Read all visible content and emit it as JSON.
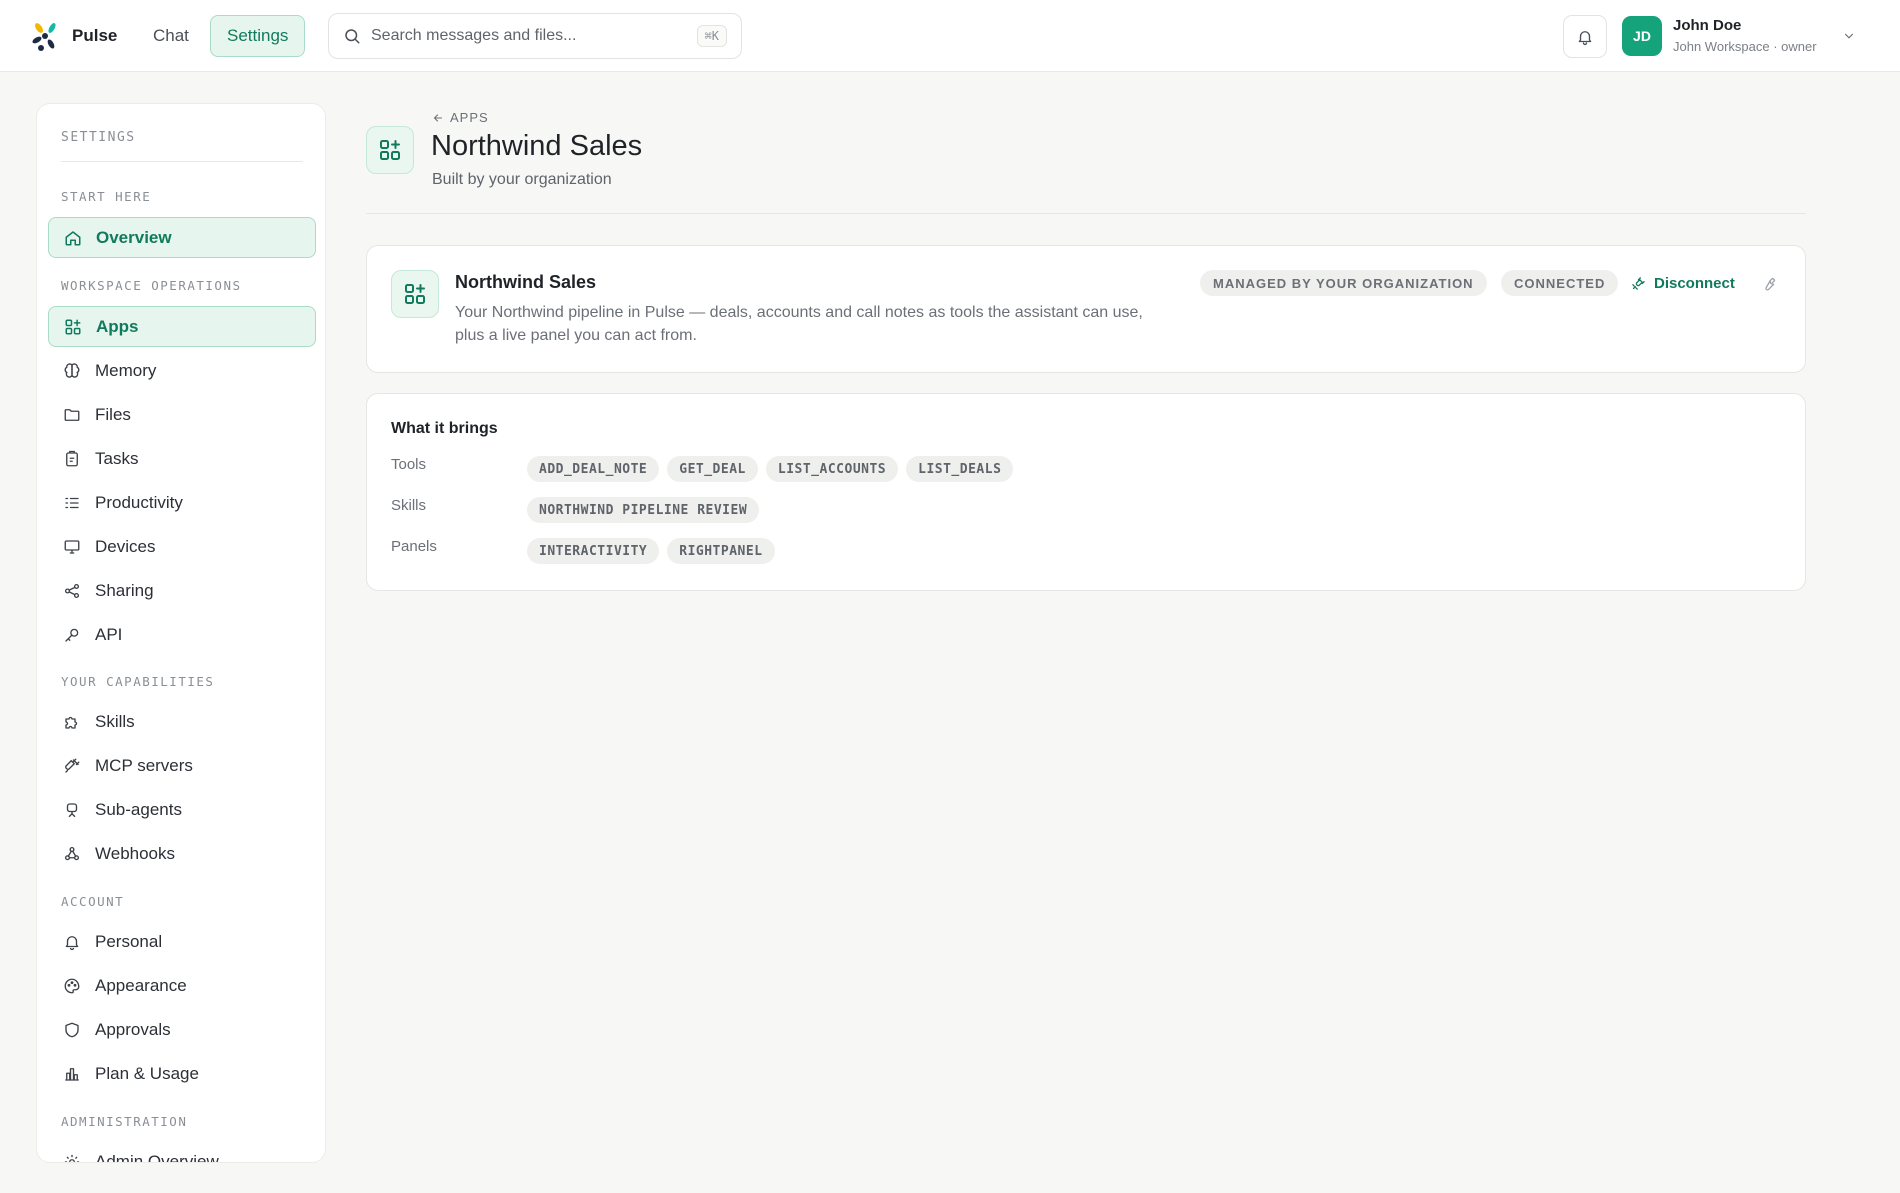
{
  "topbar": {
    "brand": "Pulse",
    "nav": {
      "chat": "Chat",
      "settings": "Settings"
    },
    "search": {
      "placeholder": "Search messages and files...",
      "shortcut": "⌘K"
    },
    "user": {
      "initials": "JD",
      "name": "John Doe",
      "subtitle": "John Workspace · owner"
    }
  },
  "sidebar": {
    "title": "SETTINGS",
    "sections": {
      "start_here": "START HERE",
      "workspace_operations": "WORKSPACE OPERATIONS",
      "your_capabilities": "YOUR CAPABILITIES",
      "account": "ACCOUNT",
      "administration": "ADMINISTRATION"
    },
    "items": {
      "overview": "Overview",
      "apps": "Apps",
      "memory": "Memory",
      "files": "Files",
      "tasks": "Tasks",
      "productivity": "Productivity",
      "devices": "Devices",
      "sharing": "Sharing",
      "api": "API",
      "skills": "Skills",
      "mcp_servers": "MCP servers",
      "sub_agents": "Sub-agents",
      "webhooks": "Webhooks",
      "personal": "Personal",
      "appearance": "Appearance",
      "approvals": "Approvals",
      "plan_usage": "Plan & Usage",
      "admin_overview": "Admin Overview"
    }
  },
  "page": {
    "back_label": "APPS",
    "title": "Northwind Sales",
    "subtitle": "Built by your organization"
  },
  "app_card": {
    "name": "Northwind Sales",
    "description": "Your Northwind pipeline in Pulse — deals, accounts and call notes as tools the assistant can use, plus a live panel you can act from.",
    "badge_managed": "MANAGED BY YOUR ORGANIZATION",
    "badge_status": "CONNECTED",
    "disconnect_label": "Disconnect"
  },
  "brings": {
    "title": "What it brings",
    "tools_label": "Tools",
    "tools": [
      "ADD_DEAL_NOTE",
      "GET_DEAL",
      "LIST_ACCOUNTS",
      "LIST_DEALS"
    ],
    "skills_label": "Skills",
    "skills": [
      "NORTHWIND PIPELINE REVIEW"
    ],
    "panels_label": "Panels",
    "panels": [
      "INTERACTIVITY",
      "RIGHTPANEL"
    ]
  },
  "colors": {
    "accent": "#117a5c",
    "accent_bg": "#e6f6ef",
    "avatar": "#14a37b"
  }
}
